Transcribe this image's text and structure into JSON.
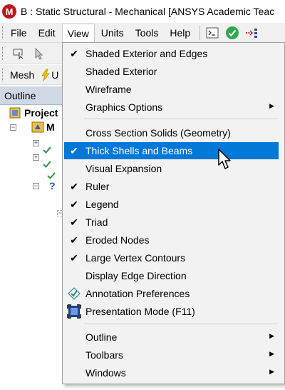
{
  "window": {
    "title": "B : Static Structural - Mechanical [ANSYS Academic Teac"
  },
  "menubar": {
    "items": [
      "File",
      "Edit",
      "View",
      "Units",
      "Tools",
      "Help"
    ],
    "active": "View"
  },
  "toolbar3": {
    "mesh_label": "Mesh",
    "partial_label": "U"
  },
  "outline": {
    "header": "Outline",
    "project_label": "Project",
    "model_label": "M"
  },
  "view_menu": {
    "groups": [
      [
        {
          "label": "Shaded Exterior and Edges",
          "checked": true
        },
        {
          "label": "Shaded Exterior",
          "checked": false
        },
        {
          "label": "Wireframe",
          "checked": false
        },
        {
          "label": "Graphics Options",
          "checked": false,
          "submenu": true
        }
      ],
      [
        {
          "label": "Cross Section Solids (Geometry)",
          "checked": false
        },
        {
          "label": "Thick Shells and Beams",
          "checked": true,
          "highlighted": true
        },
        {
          "label": "Visual Expansion",
          "checked": false
        },
        {
          "label": "Ruler",
          "checked": true
        },
        {
          "label": "Legend",
          "checked": true
        },
        {
          "label": "Triad",
          "checked": true
        },
        {
          "label": "Eroded Nodes",
          "checked": true
        },
        {
          "label": "Large Vertex Contours",
          "checked": true
        },
        {
          "label": "Display Edge Direction",
          "checked": false
        },
        {
          "label": "Annotation Preferences",
          "icon": "annotation-preferences-icon"
        },
        {
          "label": "Presentation Mode (F11)",
          "icon": "presentation-mode-icon"
        }
      ],
      [
        {
          "label": "Outline",
          "submenu": true
        },
        {
          "label": "Toolbars",
          "submenu": true
        },
        {
          "label": "Windows",
          "submenu": true
        }
      ]
    ]
  },
  "colors": {
    "highlight": "#0078d7",
    "menu_bg": "#f2f2f2",
    "title_logo": "#c0141b",
    "outline_header": "#cfd9e6"
  }
}
